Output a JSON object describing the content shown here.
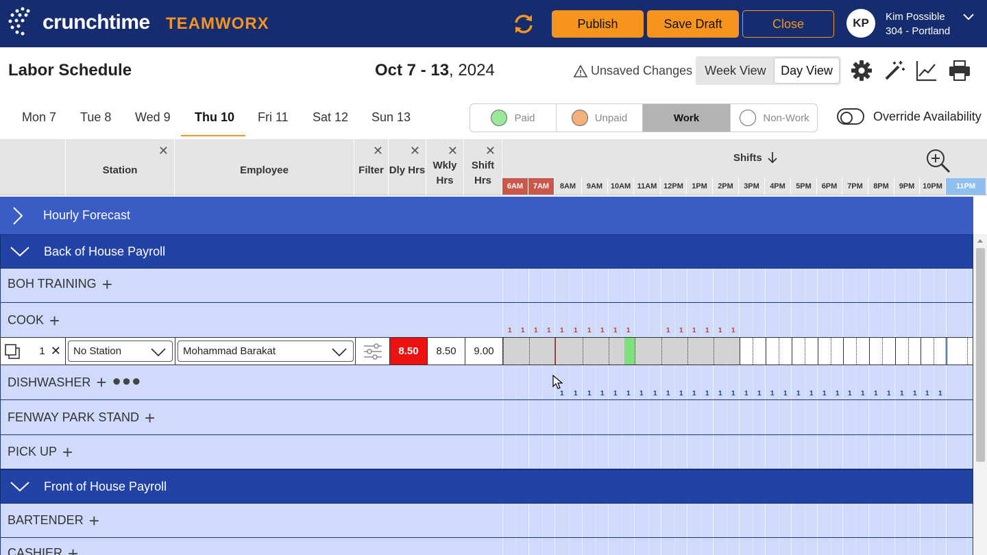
{
  "brand": {
    "name": "crunchtime",
    "product": "TEAMWORX"
  },
  "header_buttons": {
    "publish": "Publish",
    "save_draft": "Save Draft",
    "close": "Close"
  },
  "user": {
    "initials": "KP",
    "name": "Kim Possible",
    "location": "304 - Portland"
  },
  "page": {
    "title": "Labor Schedule",
    "date_bold": "Oct 7 - 13",
    "date_year": ", 2024",
    "unsaved": "Unsaved Changes"
  },
  "views": {
    "week": "Week View",
    "day": "Day View",
    "active": "Day View"
  },
  "days": [
    "Mon 7",
    "Tue 8",
    "Wed 9",
    "Thu 10",
    "Fri 11",
    "Sat 12",
    "Sun 13"
  ],
  "active_day": "Thu 10",
  "legend": {
    "paid": "Paid",
    "unpaid": "Unpaid",
    "work": "Work",
    "nonwork": "Non-Work",
    "paid_color": "#9be89b",
    "unpaid_color": "#f4b07a"
  },
  "override": {
    "label": "Override Availability"
  },
  "columns": {
    "station": "Station",
    "employee": "Employee",
    "filter": "Filter",
    "dly_hrs": "Dly Hrs",
    "wkly_hrs": "Wkly Hrs",
    "shift_hrs": "Shift Hrs",
    "shifts": "Shifts"
  },
  "hours": [
    "6AM",
    "7AM",
    "8AM",
    "9AM",
    "10AM",
    "11AM",
    "12PM",
    "1PM",
    "2PM",
    "3PM",
    "4PM",
    "5PM",
    "6PM",
    "7PM",
    "8PM",
    "9PM",
    "10PM",
    "11PM"
  ],
  "sections": {
    "forecast": "Hourly Forecast",
    "boh": "Back of House Payroll",
    "foh": "Front of House Payroll"
  },
  "stations": {
    "boh_training": "BOH TRAINING",
    "cook": "COOK",
    "dishwasher": "DISHWASHER",
    "fenway": "FENWAY PARK STAND",
    "pickup": "PICK UP",
    "bartender": "BARTENDER",
    "cashier": "CASHIER"
  },
  "shift_row": {
    "count": "1",
    "station": "No Station",
    "employee": "Mohammad Barakat",
    "dly_hrs": "8.50",
    "wkly_hrs": "8.50",
    "shift_hrs": "9.00"
  },
  "colors": {
    "navy": "#152d6e",
    "accent": "#f7941d",
    "band": "#2242a5",
    "row": "#d0dafa",
    "alert_red": "#ee1111"
  }
}
